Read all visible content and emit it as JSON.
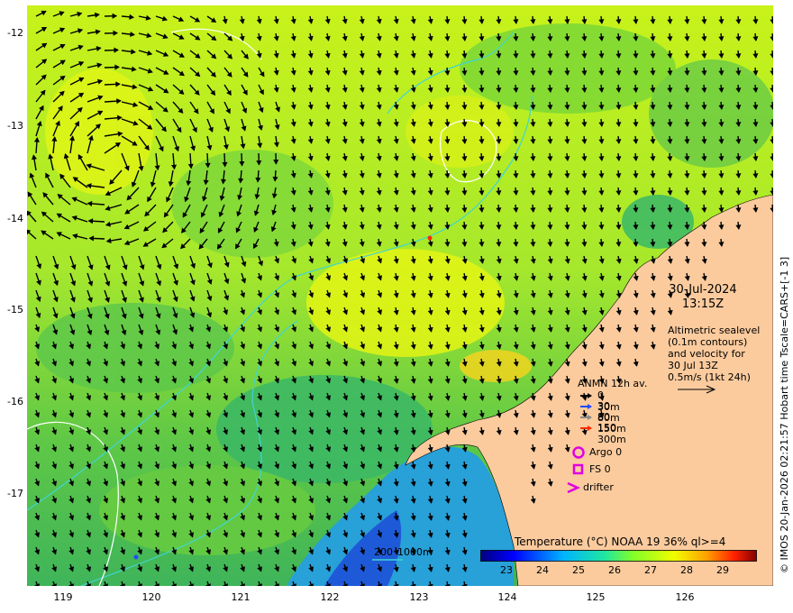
{
  "map": {
    "lat_ticks": [
      "-12",
      "-13",
      "-14",
      "-15",
      "-16",
      "-17"
    ],
    "lon_ticks": [
      "119",
      "120",
      "121",
      "122",
      "123",
      "124",
      "125",
      "126"
    ],
    "lat_range": [
      -17.95,
      -11.7
    ],
    "lon_range": [
      118.6,
      126.95
    ]
  },
  "info": {
    "date": "30-Jul-2024",
    "time": "13:15Z",
    "altimetric_lines": [
      "Altimetric sealevel",
      "(0.1m contours)",
      "and velocity for",
      "30 Jul 13Z",
      "0.5m/s (1kt 24h)"
    ]
  },
  "legend": {
    "title": "ANMN 12h av.",
    "items": [
      {
        "label": "0 30m",
        "color": "#000000"
      },
      {
        "label": "30 80m",
        "color": "#1e4dff"
      },
      {
        "label": "80 150m",
        "color": "#8a8a8a"
      },
      {
        "label": "150 300m",
        "color": "#ff2a00"
      }
    ],
    "argo": "Argo 0",
    "fs": "FS 0",
    "drifter": "drifter",
    "marker_color": "#e000e0"
  },
  "depth_legend": {
    "label_200": "200",
    "label_1000": "1000m"
  },
  "colorbar": {
    "title": "Temperature (°C) NOAA 19 36% ql>=4",
    "ticks": [
      "23",
      "24",
      "25",
      "26",
      "27",
      "28",
      "29"
    ],
    "range": [
      22.3,
      30.0
    ]
  },
  "credit": "© IMOS 20-Jan-2026 02:21:57 Hobart time Tscale=CARS+[-1 3]",
  "colors": {
    "land": "#fbcb9e",
    "bathymetry": "#3fd5d5",
    "contour": "#ffffff"
  }
}
